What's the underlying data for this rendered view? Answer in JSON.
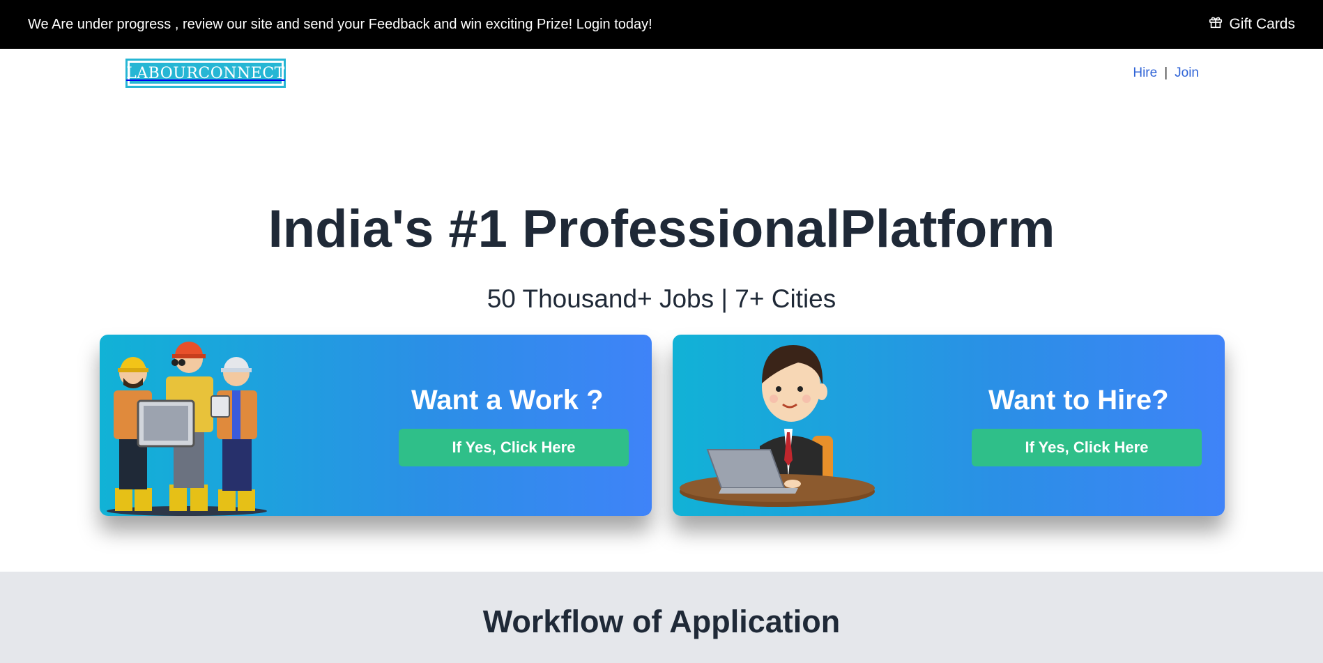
{
  "topbar": {
    "promo_text": "We Are under progress , review our site and send your Feedback and win exciting Prize!  Login today!",
    "gift_label": "Gift Cards",
    "gift_icon": "gift-icon"
  },
  "navbar": {
    "logo_text": "LABOURCONNECT",
    "links": [
      "Hire",
      "Join"
    ],
    "separator": "|"
  },
  "hero": {
    "title": "India's #1 ProfessionalPlatform",
    "subtitle": "50 Thousand+ Jobs | 7+ Cities"
  },
  "cards": [
    {
      "heading": "Want a Work ?",
      "button_label": "If Yes, Click Here",
      "illustration": "construction-workers"
    },
    {
      "heading": "Want to Hire?",
      "button_label": "If Yes, Click Here",
      "illustration": "businessman-laptop"
    }
  ],
  "workflow": {
    "title": "Workflow of Application"
  },
  "colors": {
    "topbar_bg": "#000000",
    "accent": "#26b6d4",
    "link": "#2f63d6",
    "button": "#2fbf89",
    "card_gradient_start": "#11b2d6",
    "card_gradient_end": "#3f83f8",
    "section_bg": "#e5e7eb"
  }
}
